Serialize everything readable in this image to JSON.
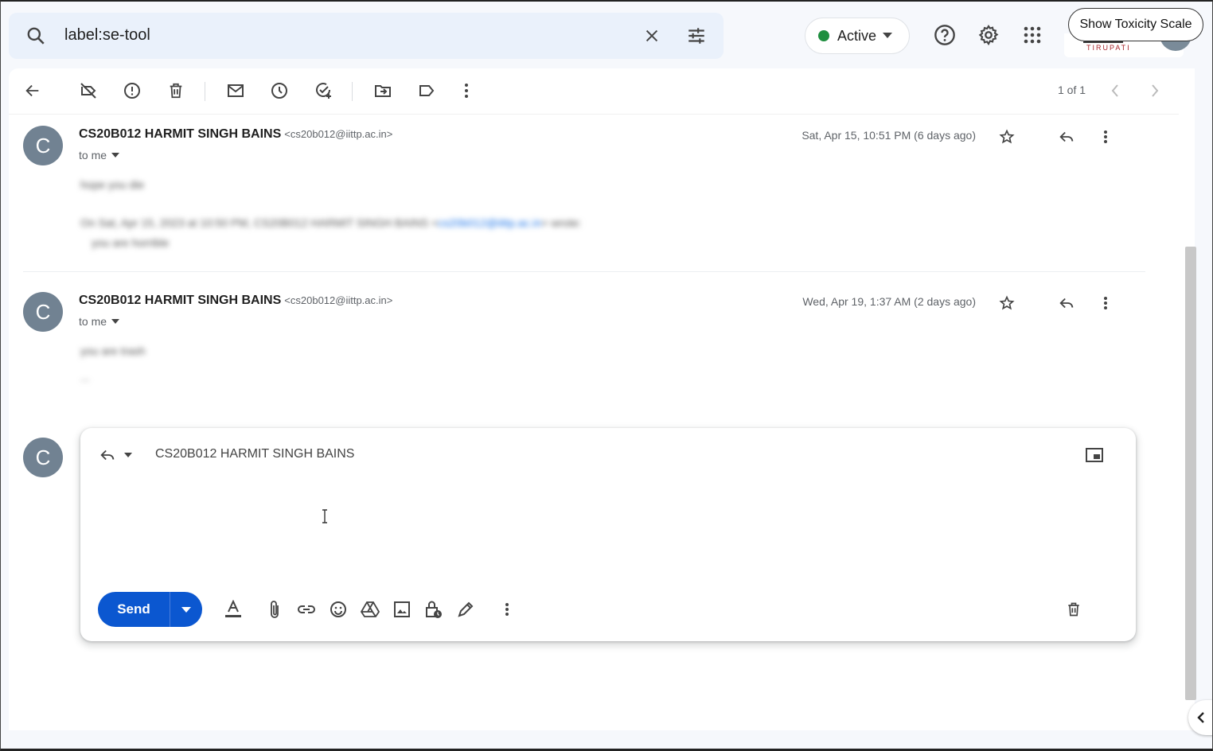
{
  "search": {
    "query": "label:se-tool"
  },
  "status": {
    "label": "Active"
  },
  "extension": {
    "toxicity_button": "Show Toxicity Scale",
    "org_label": "TIRUPATI"
  },
  "pager": {
    "text": "1 of 1"
  },
  "messages": [
    {
      "avatar_letter": "C",
      "sender": "CS20B012 HARMIT SINGH BAINS",
      "email": "<cs20b012@iittp.ac.in>",
      "to": "to me",
      "date": "Sat, Apr 15, 10:51 PM (6 days ago)"
    },
    {
      "avatar_letter": "C",
      "sender": "CS20B012 HARMIT SINGH BAINS",
      "email": "<cs20b012@iittp.ac.in>",
      "to": "to me",
      "date": "Wed, Apr 19, 1:37 AM (2 days ago)"
    }
  ],
  "reply": {
    "avatar_letter": "C",
    "to": "CS20B012 HARMIT SINGH BAINS",
    "send_label": "Send"
  }
}
